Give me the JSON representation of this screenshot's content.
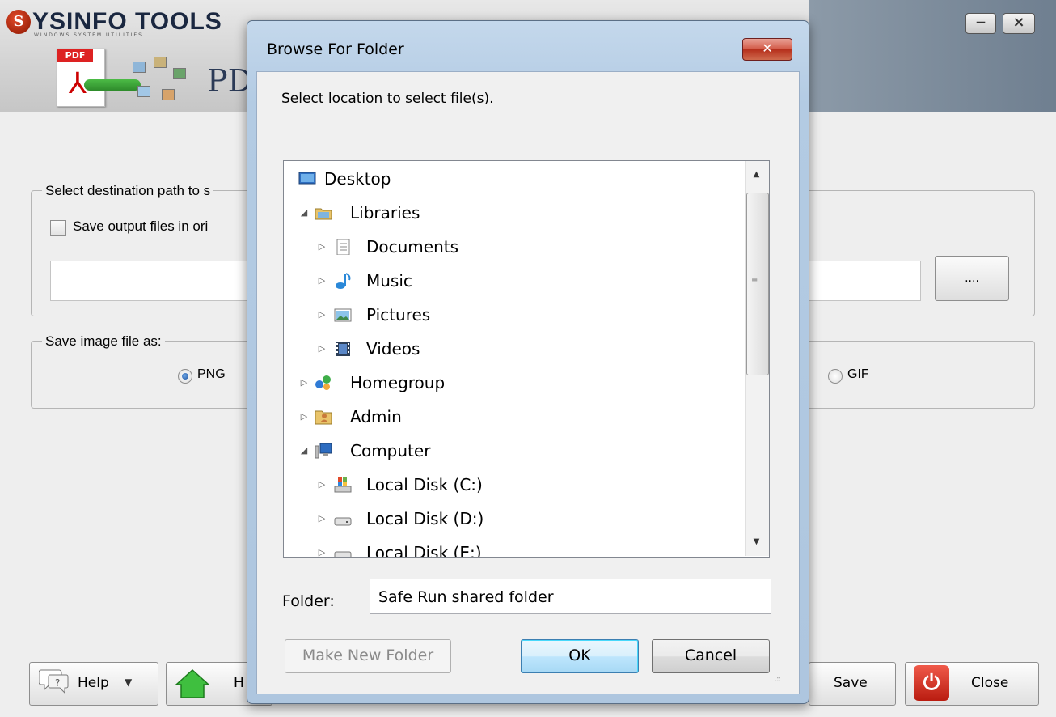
{
  "app": {
    "logo_text": "YSINFO TOOLS",
    "logo_letter": "S",
    "logo_tagline": "WINDOWS SYSTEM UTILITIES",
    "title_partial": "PD",
    "pdf_tag": "PDF",
    "min_glyph": "‒",
    "max_glyph": "⨯",
    "destination": {
      "legend": "Select destination path to s",
      "checkbox_label": "Save output files in ori",
      "path_value": "",
      "browse_label": "...."
    },
    "image_format": {
      "legend": "Save image file as:",
      "options": [
        {
          "label": "PNG",
          "selected": true
        },
        {
          "label": "GIF",
          "selected": false
        }
      ]
    },
    "buttons": {
      "help": "Help",
      "home_partial": "H",
      "save": "Save",
      "close": "Close"
    }
  },
  "dialog": {
    "title": "Browse For Folder",
    "close_glyph": "✕",
    "instruction": "Select location to select file(s).",
    "tree": [
      {
        "label": "Desktop",
        "icon": "desktop-icon",
        "expander": "",
        "level": 0
      },
      {
        "label": "Libraries",
        "icon": "libraries-icon",
        "expander": "◢",
        "level": 0
      },
      {
        "label": "Documents",
        "icon": "documents-icon",
        "expander": "▷",
        "level": 1
      },
      {
        "label": "Music",
        "icon": "music-icon",
        "expander": "▷",
        "level": 1
      },
      {
        "label": "Pictures",
        "icon": "pictures-icon",
        "expander": "▷",
        "level": 1
      },
      {
        "label": "Videos",
        "icon": "videos-icon",
        "expander": "▷",
        "level": 1
      },
      {
        "label": "Homegroup",
        "icon": "homegroup-icon",
        "expander": "▷",
        "level": 0
      },
      {
        "label": "Admin",
        "icon": "user-folder-icon",
        "expander": "▷",
        "level": 0
      },
      {
        "label": "Computer",
        "icon": "computer-icon",
        "expander": "◢",
        "level": 0
      },
      {
        "label": "Local Disk (C:)",
        "icon": "system-drive-icon",
        "expander": "▷",
        "level": 1
      },
      {
        "label": "Local Disk (D:)",
        "icon": "drive-icon",
        "expander": "▷",
        "level": 1
      },
      {
        "label": "Local Disk (E:)",
        "icon": "drive-icon",
        "expander": "▷",
        "level": 1
      }
    ],
    "folder_label": "Folder:",
    "folder_value": "Safe Run shared folder",
    "make_new_folder": "Make New Folder",
    "ok": "OK",
    "cancel": "Cancel"
  }
}
